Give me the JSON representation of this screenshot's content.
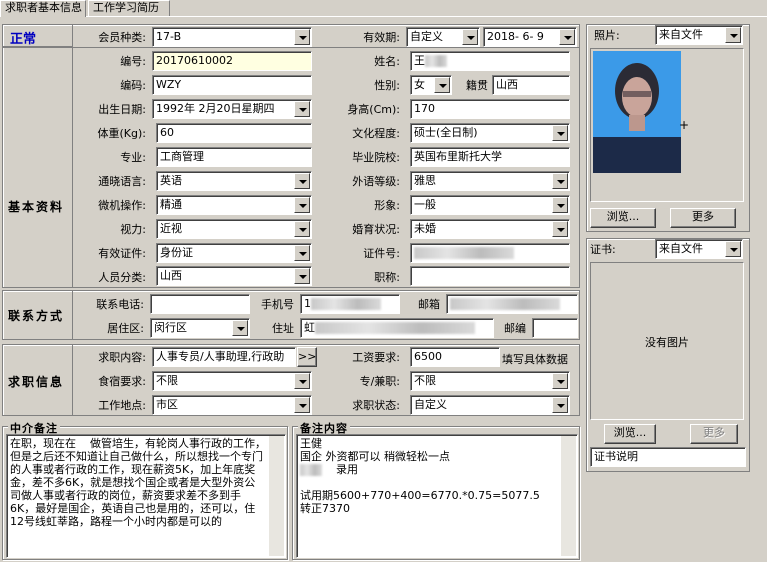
{
  "tabs": [
    "求职者基本信息",
    "工作学习简历"
  ],
  "status": "正常",
  "sections": {
    "basic": "基本资料",
    "contact": "联系方式",
    "job": "求职信息"
  },
  "fields": {
    "member_type": {
      "label": "会员种类:",
      "value": "17-B"
    },
    "validity": {
      "label": "有效期:",
      "value": "自定义",
      "date": "2018- 6- 9"
    },
    "number": {
      "label": "编号:",
      "value": "20170610002"
    },
    "name": {
      "label": "姓名:",
      "value": "王"
    },
    "code": {
      "label": "编码:",
      "value": "WZY"
    },
    "gender": {
      "label": "性别:",
      "value": "女"
    },
    "native": {
      "label": "籍贯",
      "value": "山西"
    },
    "birth": {
      "label": "出生日期:",
      "value": "1992年 2月20日星期四"
    },
    "height": {
      "label": "身高(Cm):",
      "value": "170"
    },
    "weight": {
      "label": "体重(Kg):",
      "value": "60"
    },
    "education": {
      "label": "文化程度:",
      "value": "硕士(全日制)"
    },
    "major": {
      "label": "专业:",
      "value": "工商管理"
    },
    "school": {
      "label": "毕业院校:",
      "value": "英国布里斯托大学"
    },
    "language": {
      "label": "通晓语言:",
      "value": "英语"
    },
    "lang_level": {
      "label": "外语等级:",
      "value": "雅思"
    },
    "computer": {
      "label": "微机操作:",
      "value": "精通"
    },
    "appearance": {
      "label": "形象:",
      "value": "一般"
    },
    "vision": {
      "label": "视力:",
      "value": "近视"
    },
    "marital": {
      "label": "婚育状况:",
      "value": "未婚"
    },
    "id_type": {
      "label": "有效证件:",
      "value": "身份证"
    },
    "id_number": {
      "label": "证件号:",
      "value": ""
    },
    "person_class": {
      "label": "人员分类:",
      "value": "山西"
    },
    "title": {
      "label": "职称:",
      "value": ""
    },
    "phone": {
      "label": "联系电话:",
      "value": ""
    },
    "mobile": {
      "label": "手机号",
      "value": "1"
    },
    "email": {
      "label": "邮箱",
      "value": ""
    },
    "district": {
      "label": "居住区:",
      "value": "闵行区"
    },
    "address": {
      "label": "住址",
      "value": "虹"
    },
    "postcode": {
      "label": "邮编",
      "value": ""
    },
    "job_content": {
      "label": "求职内容:",
      "value": "人事专员/人事助理,行政助"
    },
    "salary": {
      "label": "工资要求:",
      "value": "6500",
      "hint": "填写具体数据"
    },
    "board": {
      "label": "食宿要求:",
      "value": "不限"
    },
    "fulltime": {
      "label": "专/兼职:",
      "value": "不限"
    },
    "location": {
      "label": "工作地点:",
      "value": "市区"
    },
    "job_status": {
      "label": "求职状态:",
      "value": "自定义"
    }
  },
  "photo": {
    "label": "照片:",
    "source": "来自文件",
    "browse": "浏览...",
    "more": "更多"
  },
  "cert": {
    "label": "证书:",
    "source": "来自文件",
    "empty": "没有图片",
    "browse": "浏览...",
    "more": "更多",
    "desc": "证书说明"
  },
  "notes": {
    "agency_title": "中介备注",
    "agency_text": "在职，现在在    做管培生，有轮岗人事行政的工作，但是之后还不知道让自己做什么，所以想找一个专门的人事或者行政的工作，现在薪资5K，加上年底奖金，差不多6K，就是想找个国企或者是大型外资公司做人事或者行政的岗位，薪资要求差不多到手6K，最好是国企，英语自己也是用的，还可以，住12号线虹莘路，路程一个小时内都是可以的",
    "remark_title": "备注内容",
    "remark_lines": [
      "王健",
      "国企 外资都可以 稍微轻松一点",
      "    录用",
      "",
      "试用期5600+770+400=6770.*0.75=5077.5",
      "转正7370"
    ]
  },
  "more_btn": ">>"
}
